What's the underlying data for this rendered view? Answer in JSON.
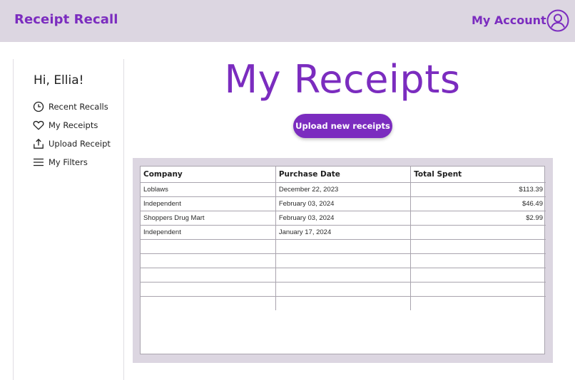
{
  "app": {
    "brand": "Receipt Recall",
    "account_label": "My Account"
  },
  "colors": {
    "accent": "#7b2cbf",
    "topbar_bg": "#dcd6e1",
    "panel_bg": "#dcd6e1"
  },
  "sidebar": {
    "greeting": "Hi, Ellia!",
    "items": [
      {
        "icon": "clock-icon",
        "label": "Recent Recalls"
      },
      {
        "icon": "heart-icon",
        "label": "My Receipts"
      },
      {
        "icon": "upload-icon",
        "label": "Upload Receipt"
      },
      {
        "icon": "menu-icon",
        "label": "My Filters"
      }
    ]
  },
  "main": {
    "title": "My Receipts",
    "upload_button": "Upload new receipts",
    "table": {
      "headers": [
        "Company",
        "Purchase Date",
        "Total Spent"
      ],
      "rows": [
        [
          "Loblaws",
          "December 22, 2023",
          "$113.39"
        ],
        [
          "Independent",
          "February 03, 2024",
          "$46.49"
        ],
        [
          "Shoppers Drug Mart",
          "February 03, 2024",
          "$2.99"
        ],
        [
          "Independent",
          "January 17, 2024",
          ""
        ],
        [
          "",
          "",
          ""
        ],
        [
          "",
          "",
          ""
        ],
        [
          "",
          "",
          ""
        ],
        [
          "",
          "",
          ""
        ],
        [
          "",
          "",
          ""
        ]
      ]
    }
  }
}
